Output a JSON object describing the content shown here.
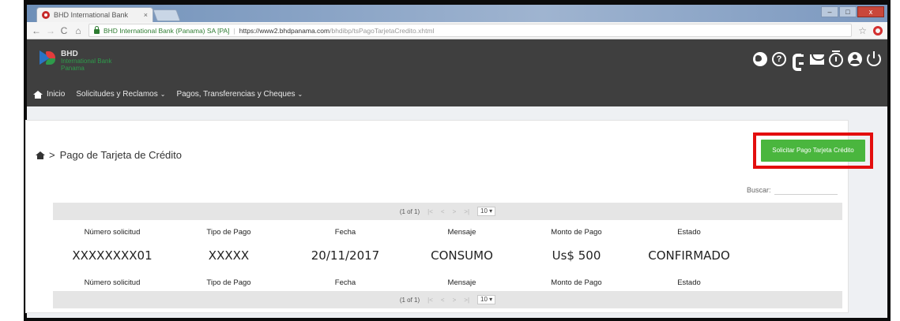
{
  "browser": {
    "tab_title": "BHD International Bank",
    "tab_close": "×",
    "win_min": "–",
    "win_max": "□",
    "win_close": "x",
    "back": "←",
    "forward": "→",
    "reload": "C",
    "home": "⌂",
    "site_label": "BHD International Bank (Panama) SA [PA]",
    "url_host": "https://www2.bhdpanama.com",
    "url_path": "/bhdibp/tsPagoTarjetaCredito.xhtml",
    "star": "☆"
  },
  "bank": {
    "logo_title": "BHD",
    "logo_sub1": "International Bank",
    "logo_sub2": "Panama",
    "nav": {
      "home_label": "Inicio",
      "solicitudes_label": "Solicitudes y Reclamos",
      "pagos_label": "Pagos, Transferencias y Cheques",
      "chevron": "⌄"
    }
  },
  "header_icons": [
    "globe-icon",
    "help-icon",
    "phone-icon",
    "mail-icon",
    "timer-icon",
    "user-icon",
    "power-icon"
  ],
  "page": {
    "breadcrumb_sep": ">",
    "breadcrumb_title": "Pago de Tarjeta de Crédito",
    "solicitar_label": "Solicitar Pago Tarjeta Crédito",
    "search_label": "Buscar:",
    "search_value": ""
  },
  "pager": {
    "info": "(1 of 1)",
    "first": "|<",
    "prev": "<",
    "next": ">",
    "last": ">|",
    "rows": "10 ▾"
  },
  "table": {
    "headers": [
      "Número solicitud",
      "Tipo de Pago",
      "Fecha",
      "Mensaje",
      "Monto de Pago",
      "Estado"
    ],
    "rows": [
      [
        "XXXXXXXX01",
        "XXXXX",
        "20/11/2017",
        "CONSUMO",
        "Us$ 500",
        "CONFIRMADO"
      ]
    ]
  },
  "colors": {
    "header_bg": "#3f3f3f",
    "accent_green": "#4ab63e",
    "highlight_red": "#e30e0e"
  }
}
